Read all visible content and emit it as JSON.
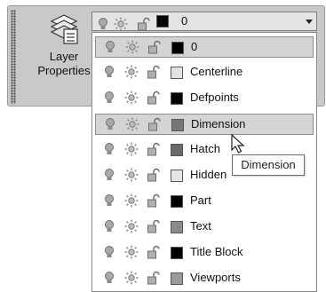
{
  "ribbon": {
    "layer_properties_label": "Layer Properties",
    "current_layer": {
      "name": "0",
      "color": "#000000"
    }
  },
  "dropdown": {
    "items": [
      {
        "name": "0",
        "color": "#000000",
        "state": "current"
      },
      {
        "name": "Centerline",
        "color": "#e2e2e2",
        "state": "normal"
      },
      {
        "name": "Defpoints",
        "color": "#000000",
        "state": "normal"
      },
      {
        "name": "Dimension",
        "color": "#777777",
        "state": "hover"
      },
      {
        "name": "Hatch",
        "color": "#6a6a6a",
        "state": "normal"
      },
      {
        "name": "Hidden",
        "color": "#e6e6e6",
        "state": "normal"
      },
      {
        "name": "Part",
        "color": "#000000",
        "state": "normal"
      },
      {
        "name": "Text",
        "color": "#8a8a8a",
        "state": "normal"
      },
      {
        "name": "Title Block",
        "color": "#000000",
        "state": "normal"
      },
      {
        "name": "Viewports",
        "color": "#9a9a9a",
        "state": "normal"
      }
    ]
  },
  "tooltip": {
    "text": "Dimension"
  }
}
